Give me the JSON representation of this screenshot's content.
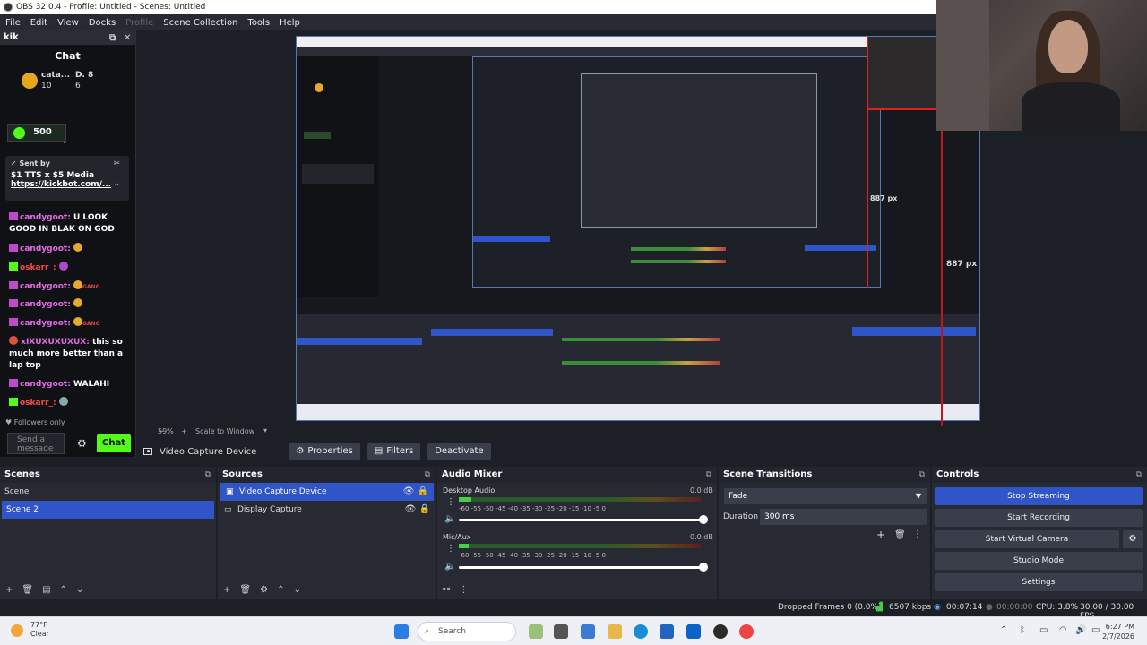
{
  "window": {
    "title": "OBS 32.0.4 - Profile: Untitled - Scenes: Untitled"
  },
  "menu": [
    "File",
    "Edit",
    "View",
    "Docks",
    "Profile",
    "Scene Collection",
    "Tools",
    "Help"
  ],
  "chat_dock": {
    "dock_title": "kik",
    "title": "Chat",
    "pinned": {
      "u1": "cata...",
      "u2": "10",
      "u3": "D. 8",
      "u4": "6"
    },
    "kick_count": "500",
    "tts_sent_by": "Sent by",
    "tts_line": "$1 TTS x $5 Media",
    "tts_link": "https://kickbot.com/...",
    "messages": [
      {
        "name": "candygoot:",
        "text": "U LOOK GOOD IN BLAK ON GOD"
      },
      {
        "name": "candygoot:",
        "text": ""
      },
      {
        "name": "oskarr_:",
        "text": ""
      },
      {
        "name": "candygoot:",
        "text": "GANG"
      },
      {
        "name": "candygoot:",
        "text": ""
      },
      {
        "name": "candygoot:",
        "text": "GANG"
      },
      {
        "name": "xIXUXUXUXUX:",
        "text": "this so much more better than a lap top"
      },
      {
        "name": "candygoot:",
        "text": "WALAHI"
      },
      {
        "name": "oskarr_:",
        "text": ""
      }
    ],
    "followers_only": "Followers only",
    "send_placeholder": "Send a message",
    "chat_button": "Chat"
  },
  "preview": {
    "label_887_top": "887 px",
    "label_887_right": "887 px"
  },
  "scale_bar": {
    "zoom": "59%",
    "mode": "Scale to Window"
  },
  "context_bar": {
    "source_name": "Video Capture Device",
    "properties": "Properties",
    "filters": "Filters",
    "deactivate": "Deactivate"
  },
  "scenes": {
    "title": "Scenes",
    "items": [
      "Scene",
      "Scene 2"
    ],
    "selected": "Scene 2"
  },
  "sources": {
    "title": "Sources",
    "items": [
      "Video Capture Device",
      "Display Capture"
    ]
  },
  "audio_mixer": {
    "title": "Audio Mixer",
    "channels": [
      {
        "name": "Desktop Audio",
        "db": "0.0 dB",
        "level": 0.05
      },
      {
        "name": "Mic/Aux",
        "db": "0.0 dB",
        "level": 0.04
      }
    ],
    "ticks": "-60  -55  -50  -45  -40  -35  -30  -25  -20  -15  -10  -5  0"
  },
  "scene_transitions": {
    "title": "Scene Transitions",
    "transition": "Fade",
    "duration_label": "Duration",
    "duration_value": "300 ms"
  },
  "controls": {
    "title": "Controls",
    "stop_streaming": "Stop Streaming",
    "start_recording": "Start Recording",
    "start_virtual_camera": "Start Virtual Camera",
    "studio_mode": "Studio Mode",
    "settings": "Settings"
  },
  "status": {
    "dropped_frames": "Dropped Frames 0 (0.0%)",
    "bitrate": "6507 kbps",
    "stream_time": "00:07:14",
    "record_time": "00:00:00",
    "cpu": "CPU: 3.8%",
    "fps": "30.00 / 30.00 FPS"
  },
  "taskbar": {
    "temp": "77°F",
    "weather": "Clear",
    "search": "Search",
    "time": "6:27 PM",
    "date": "2/7/2026"
  },
  "colors": {
    "accent": "#2f55c9",
    "kick_green": "#53fc18",
    "panel": "#272a33"
  }
}
